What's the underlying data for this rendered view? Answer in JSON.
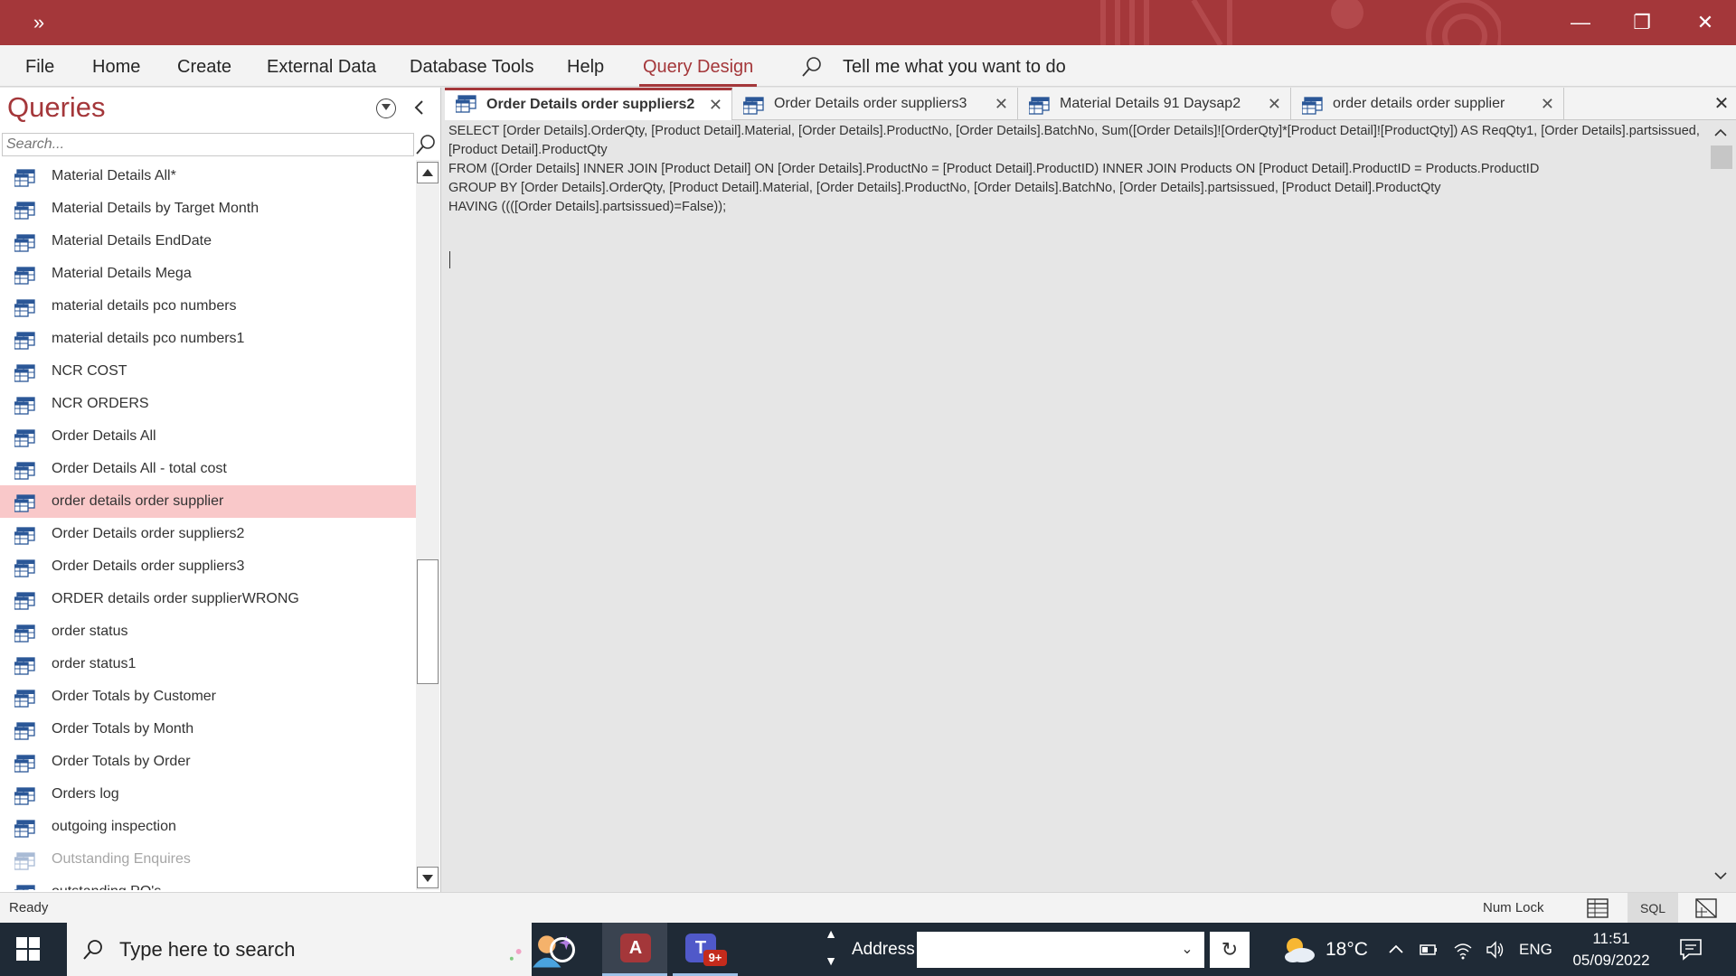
{
  "window": {
    "qat_label": "»",
    "minimize": "—",
    "restore": "❐",
    "close": "✕"
  },
  "ribbon": {
    "tabs": [
      {
        "label": "File"
      },
      {
        "label": "Home"
      },
      {
        "label": "Create"
      },
      {
        "label": "External Data"
      },
      {
        "label": "Database Tools"
      },
      {
        "label": "Help"
      },
      {
        "label": "Query Design",
        "active": true
      }
    ],
    "tell_me": "Tell me what you want to do"
  },
  "nav": {
    "title": "Queries",
    "search_placeholder": "Search...",
    "items": [
      {
        "label": "Material Details All*"
      },
      {
        "label": "Material Details by Target Month"
      },
      {
        "label": "Material Details EndDate"
      },
      {
        "label": "Material Details Mega"
      },
      {
        "label": "material details pco numbers"
      },
      {
        "label": "material details pco numbers1"
      },
      {
        "label": "NCR COST"
      },
      {
        "label": "NCR ORDERS"
      },
      {
        "label": "Order Details All"
      },
      {
        "label": "Order Details All - total cost"
      },
      {
        "label": "order details order supplier",
        "selected": true
      },
      {
        "label": "Order Details order suppliers2"
      },
      {
        "label": "Order Details order suppliers3"
      },
      {
        "label": "ORDER details order supplierWRONG"
      },
      {
        "label": "order status"
      },
      {
        "label": "order status1"
      },
      {
        "label": "Order Totals by Customer"
      },
      {
        "label": "Order Totals by Month"
      },
      {
        "label": "Order Totals by Order"
      },
      {
        "label": "Orders log"
      },
      {
        "label": "outgoing inspection"
      },
      {
        "label": "Outstanding Enquires",
        "disabled": true
      },
      {
        "label": "outstanding PO's"
      }
    ]
  },
  "doc": {
    "tabs": [
      {
        "label": "Order Details order suppliers2",
        "active": true
      },
      {
        "label": "Order Details order suppliers3"
      },
      {
        "label": "Material Details 91 Daysap2"
      },
      {
        "label": "order details order supplier"
      }
    ],
    "tab_close": "✕",
    "close_all": "✕",
    "sql": "SELECT [Order Details].OrderQty, [Product Detail].Material, [Order Details].ProductNo, [Order Details].BatchNo, Sum([Order Details]![OrderQty]*[Product Detail]![ProductQty]) AS ReqQty1, [Order Details].partsissued, [Product Detail].ProductQty\nFROM ([Order Details] INNER JOIN [Product Detail] ON [Order Details].ProductNo = [Product Detail].ProductID) INNER JOIN Products ON [Product Detail].ProductID = Products.ProductID\nGROUP BY [Order Details].OrderQty, [Product Detail].Material, [Order Details].ProductNo, [Order Details].BatchNo, [Order Details].partsissued, [Product Detail].ProductQty\nHAVING ((([Order Details].partsissued)=False));"
  },
  "status": {
    "text": "Ready",
    "numlock": "Num Lock",
    "sql_view": "SQL"
  },
  "taskbar": {
    "search_placeholder": "Type here to search",
    "access_letter": "A",
    "teams_letter": "T",
    "teams_badge": "9+",
    "address_label": "Address",
    "address_dropdown": "⌄",
    "refresh": "↻",
    "scroll_up": "▲",
    "scroll_down": "▼",
    "weather_temp": "18°C",
    "language": "ENG",
    "time": "11:51",
    "date": "05/09/2022"
  }
}
